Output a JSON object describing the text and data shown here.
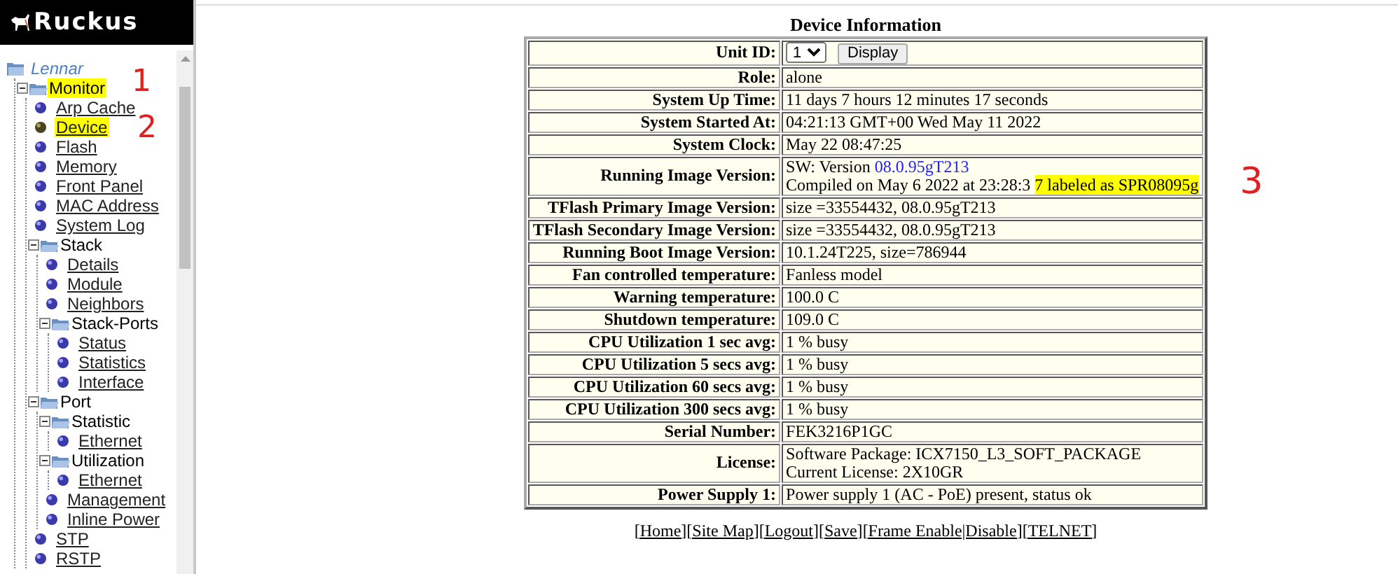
{
  "logo": {
    "text": "Ruckus"
  },
  "tree": [
    {
      "label": "Lennar",
      "kind": "root",
      "children": [
        {
          "label": "Monitor",
          "kind": "folder",
          "expanded": true,
          "highlighted": true,
          "annotation": "1",
          "children": [
            {
              "label": "Arp Cache",
              "kind": "leaf",
              "selected": false
            },
            {
              "label": "Device",
              "kind": "leaf",
              "selected": true,
              "highlighted": true,
              "annotation": "2"
            },
            {
              "label": "Flash",
              "kind": "leaf",
              "selected": false
            },
            {
              "label": "Memory",
              "kind": "leaf",
              "selected": false
            },
            {
              "label": "Front Panel",
              "kind": "leaf",
              "selected": false
            },
            {
              "label": "MAC Address",
              "kind": "leaf",
              "selected": false
            },
            {
              "label": "System Log",
              "kind": "leaf",
              "selected": false
            },
            {
              "label": "Stack",
              "kind": "folder",
              "expanded": true,
              "children": [
                {
                  "label": "Details",
                  "kind": "leaf",
                  "selected": false
                },
                {
                  "label": "Module",
                  "kind": "leaf",
                  "selected": false
                },
                {
                  "label": "Neighbors",
                  "kind": "leaf",
                  "selected": false
                },
                {
                  "label": "Stack-Ports",
                  "kind": "folder",
                  "expanded": true,
                  "children": [
                    {
                      "label": "Status",
                      "kind": "leaf",
                      "selected": false
                    },
                    {
                      "label": "Statistics",
                      "kind": "leaf",
                      "selected": false
                    },
                    {
                      "label": "Interface",
                      "kind": "leaf",
                      "selected": false
                    }
                  ]
                }
              ]
            },
            {
              "label": "Port",
              "kind": "folder",
              "expanded": true,
              "children": [
                {
                  "label": "Statistic",
                  "kind": "folder",
                  "expanded": true,
                  "children": [
                    {
                      "label": "Ethernet",
                      "kind": "leaf",
                      "selected": false
                    }
                  ]
                },
                {
                  "label": "Utilization",
                  "kind": "folder",
                  "expanded": true,
                  "children": [
                    {
                      "label": "Ethernet",
                      "kind": "leaf",
                      "selected": false
                    }
                  ]
                },
                {
                  "label": "Management",
                  "kind": "leaf",
                  "selected": false
                },
                {
                  "label": "Inline Power",
                  "kind": "leaf",
                  "selected": false
                }
              ]
            },
            {
              "label": "STP",
              "kind": "leaf",
              "selected": false
            },
            {
              "label": "RSTP",
              "kind": "leaf",
              "selected": false
            }
          ]
        }
      ]
    }
  ],
  "panel": {
    "title": "Device Information",
    "rows": [
      {
        "label": "Unit ID:",
        "kind": "select",
        "select_value": "1",
        "button": "Display"
      },
      {
        "label": "Role:",
        "kind": "text",
        "lines": [
          [
            {
              "text": "alone",
              "kind": "plain"
            }
          ]
        ]
      },
      {
        "label": "System Up Time:",
        "kind": "text",
        "lines": [
          [
            {
              "text": "11 days 7 hours 12 minutes 17 seconds",
              "kind": "plain"
            }
          ]
        ]
      },
      {
        "label": "System Started At:",
        "kind": "text",
        "lines": [
          [
            {
              "text": "04:21:13 GMT+00 Wed May 11 2022",
              "kind": "plain"
            }
          ]
        ]
      },
      {
        "label": "System Clock:",
        "kind": "text",
        "lines": [
          [
            {
              "text": "May 22 08:47:25",
              "kind": "plain"
            }
          ]
        ]
      },
      {
        "label": "Running Image Version:",
        "kind": "text",
        "annotation": "3",
        "lines": [
          [
            {
              "text": "SW: Version",
              "kind": "plain"
            },
            {
              "text": "08.0.95gT213",
              "kind": "link"
            }
          ],
          [
            {
              "text": "Compiled on May 6 2022 at 23:28:3",
              "kind": "plain"
            },
            {
              "text": "7 labeled as SPR08095g",
              "kind": "highlight"
            }
          ]
        ]
      },
      {
        "label": "TFlash Primary Image Version:",
        "kind": "text",
        "lines": [
          [
            {
              "text": "size =33554432, 08.0.95gT213",
              "kind": "plain"
            }
          ]
        ]
      },
      {
        "label": "TFlash Secondary Image Version:",
        "kind": "text",
        "lines": [
          [
            {
              "text": "size =33554432, 08.0.95gT213",
              "kind": "plain"
            }
          ]
        ]
      },
      {
        "label": "Running Boot Image Version:",
        "kind": "text",
        "lines": [
          [
            {
              "text": "10.1.24T225, size=786944",
              "kind": "plain"
            }
          ]
        ]
      },
      {
        "label": "Fan controlled temperature:",
        "kind": "text",
        "lines": [
          [
            {
              "text": "Fanless model",
              "kind": "plain"
            }
          ]
        ]
      },
      {
        "label": "Warning temperature:",
        "kind": "text",
        "lines": [
          [
            {
              "text": "100.0 C",
              "kind": "plain"
            }
          ]
        ]
      },
      {
        "label": "Shutdown temperature:",
        "kind": "text",
        "lines": [
          [
            {
              "text": "109.0 C",
              "kind": "plain"
            }
          ]
        ]
      },
      {
        "label": "CPU Utilization 1 sec avg:",
        "kind": "text",
        "lines": [
          [
            {
              "text": "1 % busy",
              "kind": "plain"
            }
          ]
        ]
      },
      {
        "label": "CPU Utilization 5 secs avg:",
        "kind": "text",
        "lines": [
          [
            {
              "text": "1 % busy",
              "kind": "plain"
            }
          ]
        ]
      },
      {
        "label": "CPU Utilization 60 secs avg:",
        "kind": "text",
        "lines": [
          [
            {
              "text": "1 % busy",
              "kind": "plain"
            }
          ]
        ]
      },
      {
        "label": "CPU Utilization 300 secs avg:",
        "kind": "text",
        "lines": [
          [
            {
              "text": "1 % busy",
              "kind": "plain"
            }
          ]
        ]
      },
      {
        "label": "Serial Number:",
        "kind": "text",
        "lines": [
          [
            {
              "text": "FEK3216P1GC",
              "kind": "plain"
            }
          ]
        ]
      },
      {
        "label": "License:",
        "kind": "text",
        "lines": [
          [
            {
              "text": "Software Package: ICX7150_L3_SOFT_PACKAGE",
              "kind": "plain"
            }
          ],
          [
            {
              "text": "Current License: 2X10GR",
              "kind": "plain"
            }
          ]
        ]
      },
      {
        "label": "Power Supply 1:",
        "kind": "text",
        "lines": [
          [
            {
              "text": "Power supply 1 (AC - PoE) present, status ok",
              "kind": "plain"
            }
          ]
        ]
      }
    ],
    "footer_links": [
      "[Home]",
      "[Site Map]",
      "[Logout]",
      "[Save]",
      "[Frame Enable|Disable]",
      "[TELNET]"
    ]
  }
}
